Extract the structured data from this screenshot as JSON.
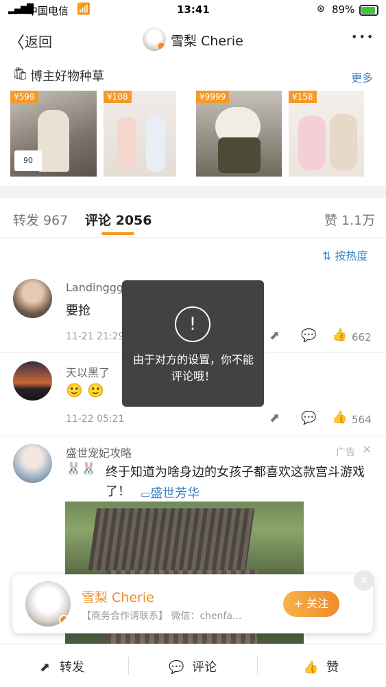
{
  "status": {
    "carrier": "中国电信",
    "time": "13:41",
    "battery": "89%"
  },
  "nav": {
    "back": "返回",
    "title": "雪梨 Cherie",
    "more": "•••"
  },
  "shop": {
    "title": "博主好物种草",
    "more": "更多",
    "items": [
      {
        "price": "¥599"
      },
      {
        "price": "¥108"
      },
      {
        "price": "¥9999"
      },
      {
        "price": "¥158"
      }
    ],
    "thumb_caption": "90"
  },
  "tabs": {
    "repost": "转发 967",
    "comments": "评论 2056",
    "likes": "赞 1.1万"
  },
  "sort": {
    "label": "按热度"
  },
  "comments": [
    {
      "name": "Landinggg",
      "text": "要抢",
      "time": "11-21 21:29",
      "likes": "662"
    },
    {
      "name": "天以黑了",
      "text": "🙂 🙂",
      "time": "11-22 05:21",
      "likes": "564"
    },
    {
      "name": "盛世宠妃攻略",
      "text": "终于知道为啥身边的女孩子都喜欢这款宫斗游戏了！",
      "ad_link": "盛世芳华",
      "ad_label": "广告"
    }
  ],
  "toast": {
    "icon": "!",
    "message": "由于对方的设置，你不能评论哦！"
  },
  "follow_card": {
    "name": "雪梨 Cherie",
    "desc": "【商务合作请联系】 微信：chenfa...",
    "button": "+ 关注"
  },
  "bottom": {
    "repost": "转发",
    "comment": "评论",
    "like": "赞"
  },
  "colors": {
    "accent": "#f39a2b",
    "link": "#3b83c4",
    "name_orange": "#f08c2c"
  }
}
